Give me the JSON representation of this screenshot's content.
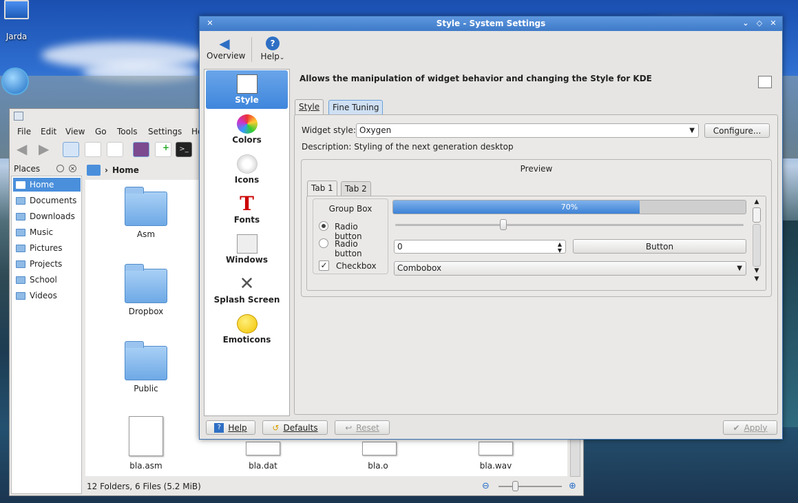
{
  "desktop": {
    "user_icon_label": "Jarda",
    "globe_icon_label": ""
  },
  "dolphin": {
    "menu": [
      "File",
      "Edit",
      "View",
      "Go",
      "Tools",
      "Settings",
      "He"
    ],
    "places_label": "Places",
    "places": [
      "Home",
      "Documents",
      "Downloads",
      "Music",
      "Pictures",
      "Projects",
      "School",
      "Videos"
    ],
    "breadcrumb": "Home",
    "files": [
      {
        "name": "Asm",
        "type": "folder"
      },
      {
        "name": "Dropbox",
        "type": "folder-images"
      },
      {
        "name": "Public",
        "type": "folder"
      },
      {
        "name": "bla.asm",
        "type": "text"
      },
      {
        "name": "bla.dat",
        "type": "data"
      },
      {
        "name": "bla.o",
        "type": "data"
      },
      {
        "name": "bla.wav",
        "type": "audio"
      }
    ],
    "status": "12 Folders, 6 Files (5.2 MiB)"
  },
  "settings": {
    "title": "Style - System Settings",
    "overview_label": "Overview",
    "help_menu_label": "Help",
    "categories": [
      "Style",
      "Colors",
      "Icons",
      "Fonts",
      "Windows",
      "Splash Screen",
      "Emoticons"
    ],
    "description_header": "Allows the manipulation of widget behavior and changing the Style for KDE",
    "tabs": [
      "Style",
      "Fine Tuning"
    ],
    "widget_style_label": "Widget style:",
    "widget_style_value": "Oxygen",
    "configure_label": "Configure...",
    "description": "Description: Styling of the next generation desktop",
    "preview": {
      "title": "Preview",
      "tabs": [
        "Tab 1",
        "Tab 2"
      ],
      "group_box": "Group Box",
      "radio1": "Radio button",
      "radio2": "Radio button",
      "checkbox": "Checkbox",
      "progress": 0.7,
      "progress_label": "70%",
      "slider": 0.31,
      "spin_value": "0",
      "button": "Button",
      "combobox": "Combobox"
    },
    "footer": {
      "help": "Help",
      "defaults": "Defaults",
      "reset": "Reset",
      "apply": "Apply"
    }
  }
}
